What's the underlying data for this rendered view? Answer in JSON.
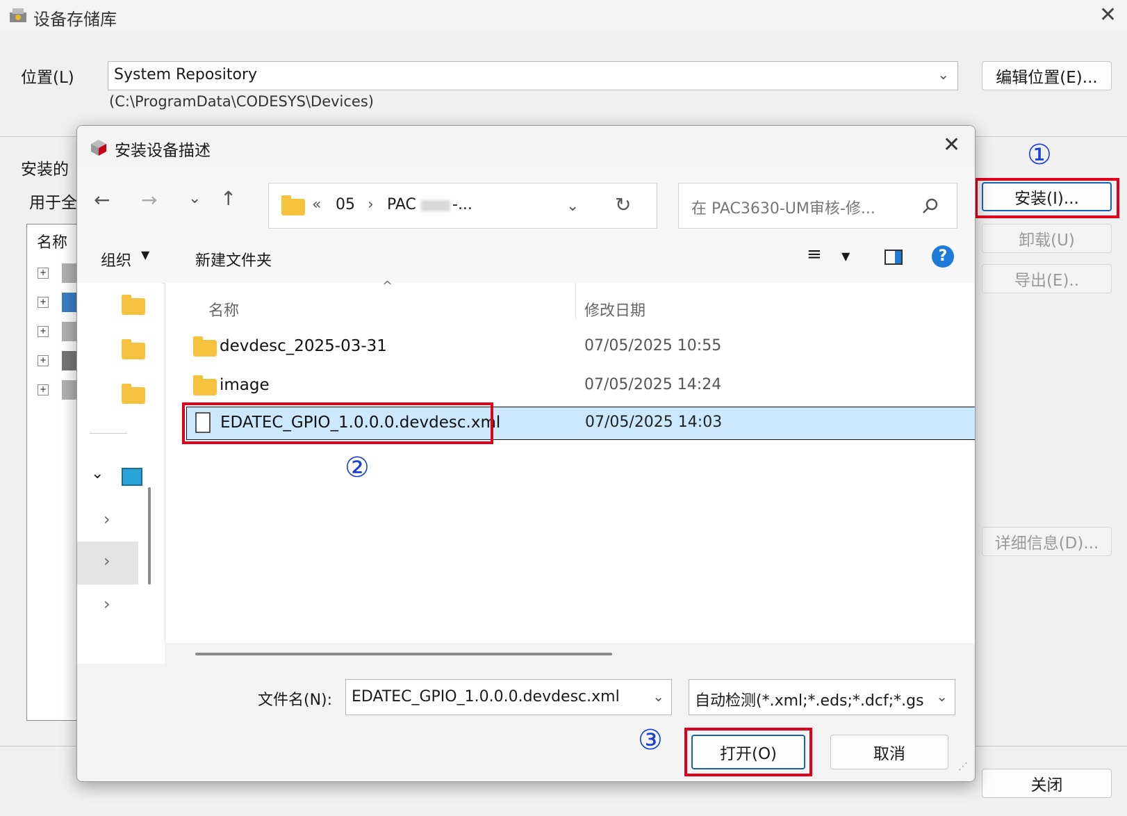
{
  "back_window": {
    "title": "设备存储库",
    "close_glyph": "✕",
    "location_label": "位置(L)",
    "location_value": "System Repository",
    "location_path": "(C:\\ProgramData\\CODESYS\\Devices)",
    "edit_location": "编辑位置(E)...",
    "installed_label": "安装的",
    "for_all_label": "用于全",
    "tree_header": "名称",
    "install_button": "安装(I)...",
    "uninstall_button": "卸载(U)",
    "export_button": "导出(E)..",
    "details_button": "详细信息(D)...",
    "close_button": "关闭"
  },
  "dialog": {
    "title": "安装设备描述",
    "close_glyph": "✕",
    "breadcrumb": [
      "«",
      "05",
      "›",
      "PAC",
      "-..."
    ],
    "search_placeholder": "在 PAC3630-UM审核-修...",
    "organize": "组织",
    "new_folder": "新建文件夹",
    "columns": {
      "name": "名称",
      "modified": "修改日期"
    },
    "files": [
      {
        "name": "devdesc_2025-03-31",
        "date": "07/05/2025 10:55",
        "type": "folder"
      },
      {
        "name": "image",
        "date": "07/05/2025 14:24",
        "type": "folder"
      },
      {
        "name": "EDATEC_GPIO_1.0.0.0.devdesc.xml",
        "date": "07/05/2025 14:03",
        "type": "file"
      }
    ],
    "filename_label": "文件名(N):",
    "filename_value": "EDATEC_GPIO_1.0.0.0.devdesc.xml",
    "filter_value": "自动检测(*.xml;*.eds;*.dcf;*.gs",
    "open_button": "打开(O)",
    "cancel_button": "取消"
  },
  "annotations": {
    "one": "①",
    "two": "②",
    "three": "③"
  },
  "colors": {
    "annotation_red": "#e0001b",
    "annotation_blue": "#1a3fd6",
    "selection": "#cce8ff"
  }
}
